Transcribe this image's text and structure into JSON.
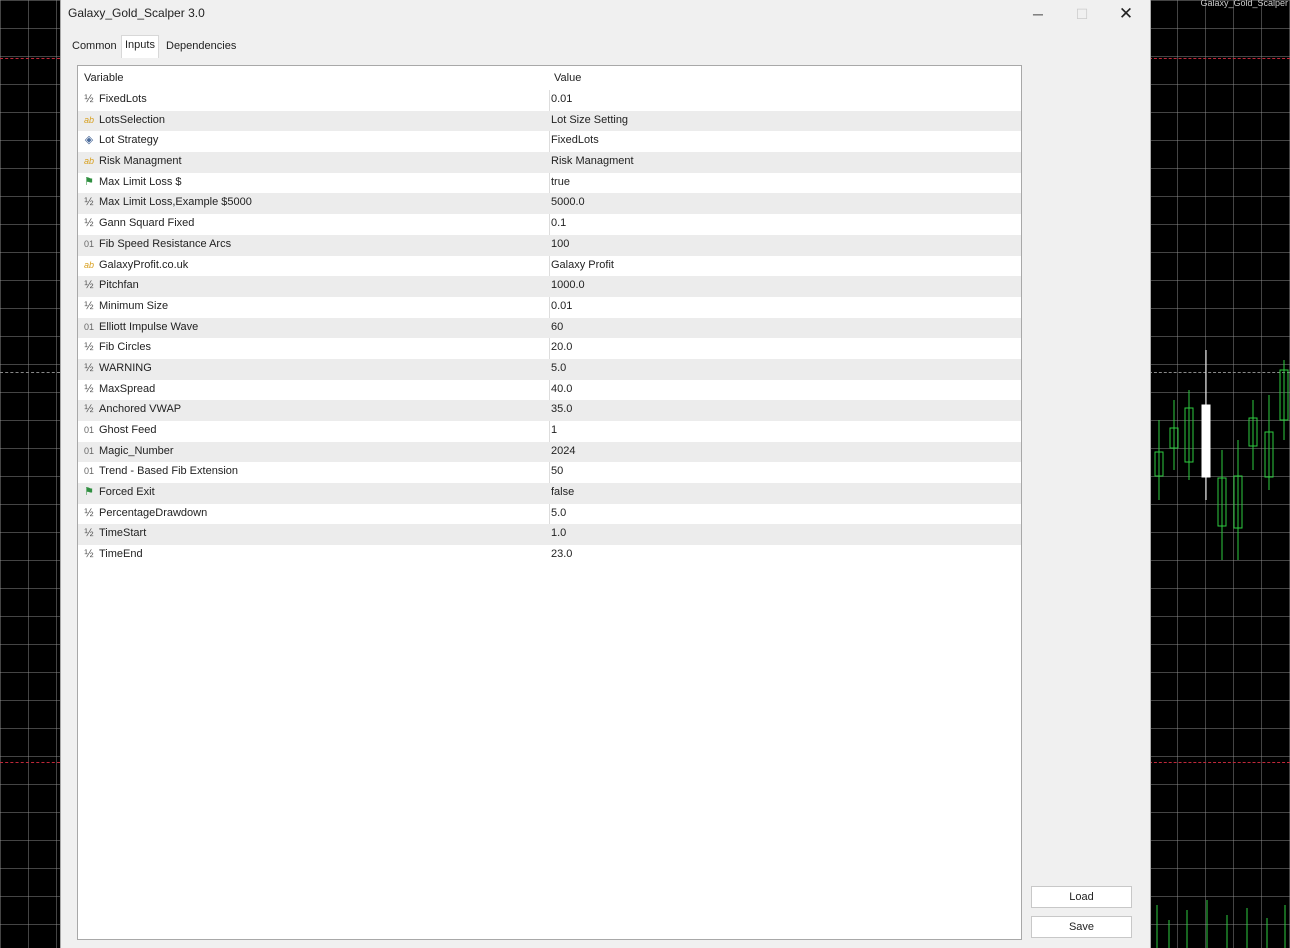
{
  "window": {
    "title": "Galaxy_Gold_Scalper 3.0",
    "minimize_glyph": "─",
    "maximize_glyph": "☐",
    "close_glyph": "✕"
  },
  "chart": {
    "indicator_label": "Galaxy_Gold_Scalper",
    "background_color": "#000000",
    "bull_color": "#2ecc40",
    "bear_color": "#ffffff"
  },
  "tabs": [
    {
      "label": "Common"
    },
    {
      "label": "Inputs",
      "selected": true
    },
    {
      "label": "Dependencies"
    }
  ],
  "table": {
    "headers": {
      "variable": "Variable",
      "value": "Value"
    },
    "rows": [
      {
        "icon": "double-icon",
        "glyph": "½",
        "variable": "FixedLots",
        "value": "0.01"
      },
      {
        "icon": "string-icon",
        "glyph": "ab",
        "variable": "LotsSelection",
        "value": "Lot Size Setting"
      },
      {
        "icon": "enum-icon",
        "glyph": "◈",
        "variable": "Lot Strategy",
        "value": "FixedLots"
      },
      {
        "icon": "string-icon",
        "glyph": "ab",
        "variable": "Risk Managment",
        "value": "Risk Managment"
      },
      {
        "icon": "bool-icon",
        "glyph": "⚑",
        "variable": "Max Limit Loss $",
        "value": "true"
      },
      {
        "icon": "double-icon",
        "glyph": "½",
        "variable": "Max Limit Loss,Example $5000",
        "value": "5000.0"
      },
      {
        "icon": "double-icon",
        "glyph": "½",
        "variable": "Gann Squard Fixed",
        "value": "0.1"
      },
      {
        "icon": "int-icon",
        "glyph": "01",
        "variable": "Fib Speed Resistance Arcs",
        "value": "100"
      },
      {
        "icon": "string-icon",
        "glyph": "ab",
        "variable": "GalaxyProfit.co.uk",
        "value": "Galaxy Profit"
      },
      {
        "icon": "double-icon",
        "glyph": "½",
        "variable": "Pitchfan",
        "value": "1000.0"
      },
      {
        "icon": "double-icon",
        "glyph": "½",
        "variable": "Minimum Size",
        "value": "0.01"
      },
      {
        "icon": "int-icon",
        "glyph": "01",
        "variable": "Elliott Impulse Wave",
        "value": "60"
      },
      {
        "icon": "double-icon",
        "glyph": "½",
        "variable": "Fib Circles",
        "value": "20.0"
      },
      {
        "icon": "double-icon",
        "glyph": "½",
        "variable": "WARNING",
        "value": "5.0"
      },
      {
        "icon": "double-icon",
        "glyph": "½",
        "variable": "MaxSpread",
        "value": "40.0"
      },
      {
        "icon": "double-icon",
        "glyph": "½",
        "variable": "Anchored VWAP",
        "value": "35.0"
      },
      {
        "icon": "int-icon",
        "glyph": "01",
        "variable": "Ghost Feed",
        "value": "1"
      },
      {
        "icon": "int-icon",
        "glyph": "01",
        "variable": "Magic_Number",
        "value": "2024"
      },
      {
        "icon": "int-icon",
        "glyph": "01",
        "variable": "Trend - Based Fib Extension",
        "value": "50"
      },
      {
        "icon": "bool-icon",
        "glyph": "⚑",
        "variable": "Forced Exit",
        "value": "false"
      },
      {
        "icon": "double-icon",
        "glyph": "½",
        "variable": "PercentageDrawdown",
        "value": "5.0"
      },
      {
        "icon": "double-icon",
        "glyph": "½",
        "variable": "TimeStart",
        "value": "1.0"
      },
      {
        "icon": "double-icon",
        "glyph": "½",
        "variable": "TimeEnd",
        "value": "23.0"
      }
    ]
  },
  "buttons": {
    "load": "Load",
    "save": "Save"
  }
}
